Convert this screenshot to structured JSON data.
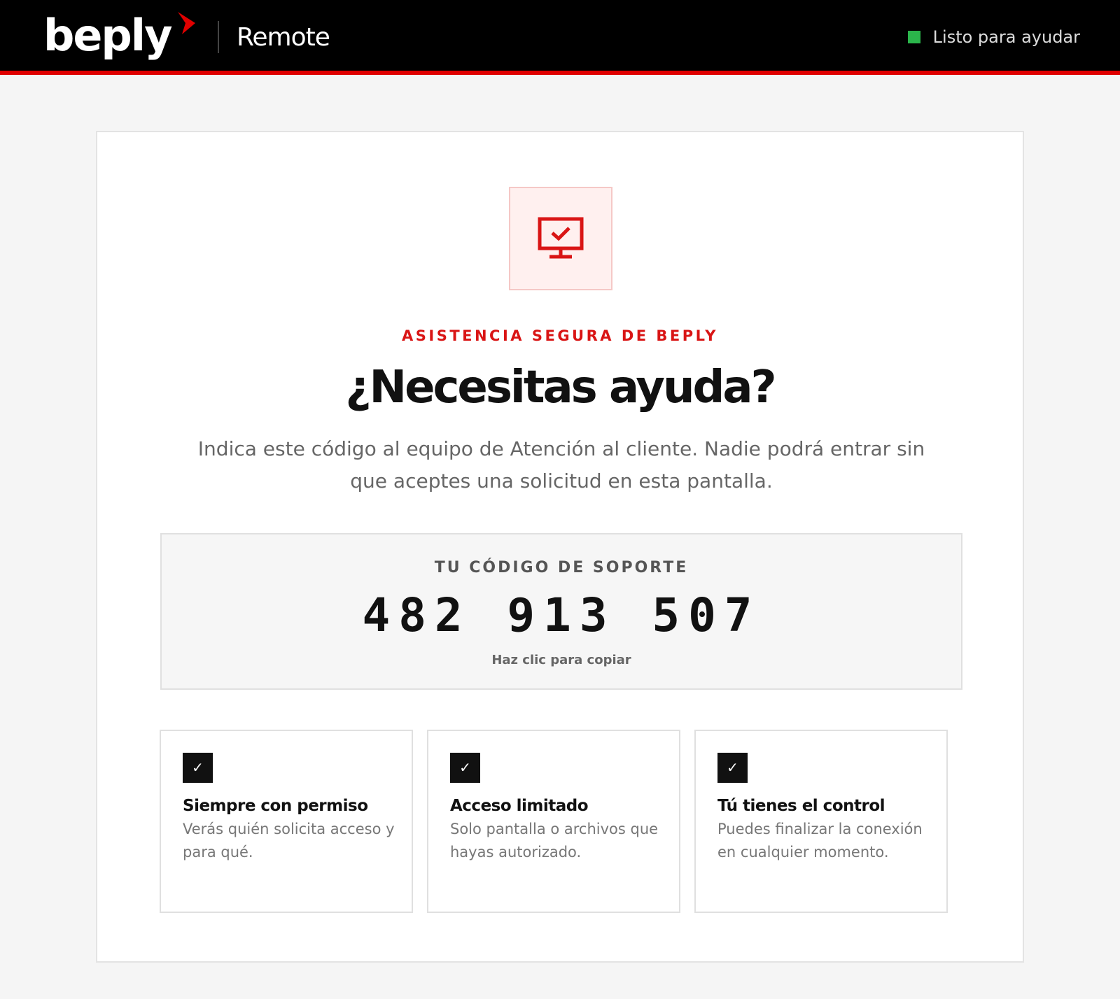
{
  "header": {
    "brand": "beply",
    "product": "Remote",
    "status_text": "Listo para ayudar",
    "colors": {
      "accent": "#e00000",
      "status": "#2bb54b"
    }
  },
  "main": {
    "icon": "monitor-check-icon",
    "eyebrow": "ASISTENCIA SEGURA DE BEPLY",
    "headline": "¿Necesitas ayuda?",
    "intro": "Indica este código al equipo de Atención al cliente. Nadie podrá entrar sin que aceptes una solicitud en esta pantalla.",
    "code": {
      "label": "TU CÓDIGO DE SOPORTE",
      "value": "482 913 507",
      "hint": "Haz clic para copiar"
    },
    "features": [
      {
        "icon": "check-icon",
        "title": "Siempre con permiso",
        "description": "Verás quién solicita acceso y para qué."
      },
      {
        "icon": "check-icon",
        "title": "Acceso limitado",
        "description": "Solo pantalla o archivos que hayas autorizado."
      },
      {
        "icon": "check-icon",
        "title": "Tú tienes el control",
        "description": "Puedes finalizar la conexión en cualquier momento."
      }
    ]
  }
}
